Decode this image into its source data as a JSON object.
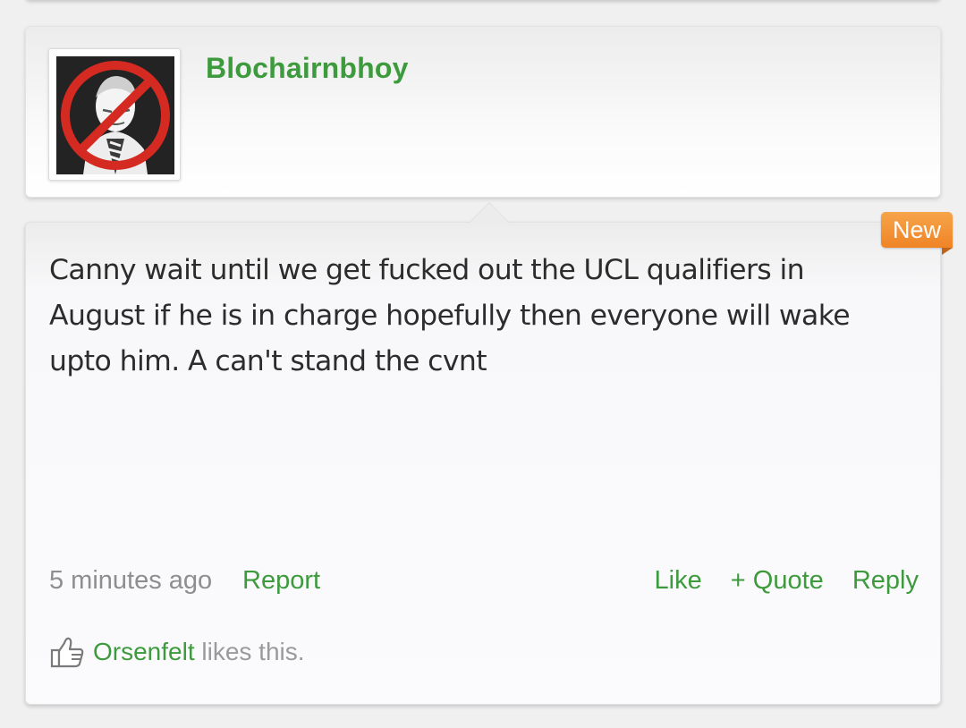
{
  "post": {
    "username": "Blochairnbhoy",
    "new_badge": "New",
    "message": "Canny wait until we get fucked out the UCL qualifiers in August if he is in charge hopefully then everyone will wake upto him. A can't stand the cvnt",
    "timestamp": "5 minutes ago",
    "report_label": "Report",
    "actions": {
      "like": "Like",
      "quote": "+ Quote",
      "reply": "Reply"
    },
    "likes": {
      "icon": "thumbs-up-icon",
      "user": "Orsenfelt",
      "suffix": " likes this."
    }
  },
  "colors": {
    "link_green": "#3d9a3d",
    "badge_orange": "#ef8426",
    "muted_gray": "#8e8e8e",
    "text_dark": "#2c2c2c"
  }
}
